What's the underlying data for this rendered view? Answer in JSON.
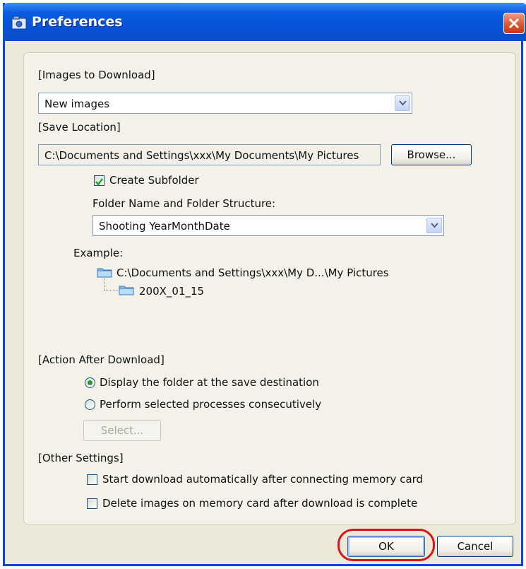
{
  "window": {
    "title": "Preferences"
  },
  "images_to_download": {
    "section_label": "[Images to Download]",
    "selected": "New images"
  },
  "save_location": {
    "section_label": "[Save Location]",
    "path": "C:\\Documents and Settings\\xxx\\My Documents\\My Pictures",
    "browse_label": "Browse...",
    "create_subfolder_label": "Create Subfolder",
    "create_subfolder_checked": true,
    "folder_structure_label": "Folder Name and Folder Structure:",
    "folder_structure_selected": "Shooting YearMonthDate",
    "example_label": "Example:",
    "example_parent": "C:\\Documents and Settings\\xxx\\My D...\\My Pictures",
    "example_child": "200X_01_15"
  },
  "action_after_download": {
    "section_label": "[Action After Download]",
    "option_display": "Display the folder at the save destination",
    "option_perform": "Perform selected processes consecutively",
    "selected": "display",
    "select_button": "Select..."
  },
  "other_settings": {
    "section_label": "[Other Settings]",
    "auto_start_label": "Start download automatically after connecting memory card",
    "auto_start_checked": false,
    "delete_label": "Delete images on memory card after download is complete",
    "delete_checked": false
  },
  "footer": {
    "ok_label": "OK",
    "cancel_label": "Cancel"
  },
  "colors": {
    "title_bar": "#0753d8",
    "highlight_ring": "#d8141c",
    "radio_dot": "#2a9a2a"
  }
}
